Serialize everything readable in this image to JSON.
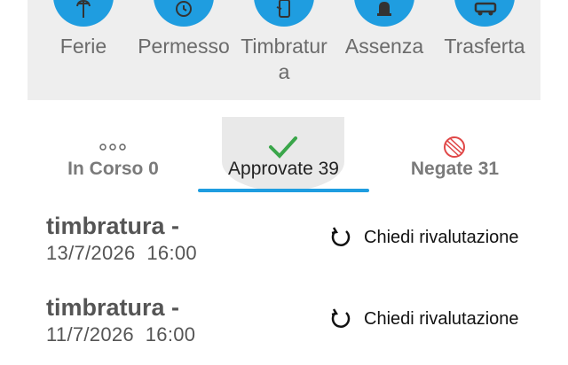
{
  "quick_actions": [
    {
      "label": "Ferie",
      "icon": "beach-icon"
    },
    {
      "label": "Permesso",
      "icon": "clock-icon"
    },
    {
      "label": "Timbratura",
      "icon": "badge-device-icon"
    },
    {
      "label": "Assenza",
      "icon": "bell-icon"
    },
    {
      "label": "Trasferta",
      "icon": "car-icon"
    }
  ],
  "tabs": [
    {
      "label": "In Corso 0",
      "icon": "dots-icon",
      "active": false
    },
    {
      "label": "Approvate 39",
      "icon": "check-icon",
      "active": true
    },
    {
      "label": "Negate 31",
      "icon": "blocked-icon",
      "active": false
    }
  ],
  "requests": [
    {
      "title": "timbratura -",
      "date": "13/7/2026  16:00",
      "action_label": "Chiedi rivalutazione"
    },
    {
      "title": "timbratura -",
      "date": "11/7/2026  16:00",
      "action_label": "Chiedi rivalutazione"
    }
  ],
  "colors": {
    "accent": "#1f9de0",
    "approved": "#3aa64a",
    "denied": "#e04848",
    "panel": "#eeeeee"
  }
}
